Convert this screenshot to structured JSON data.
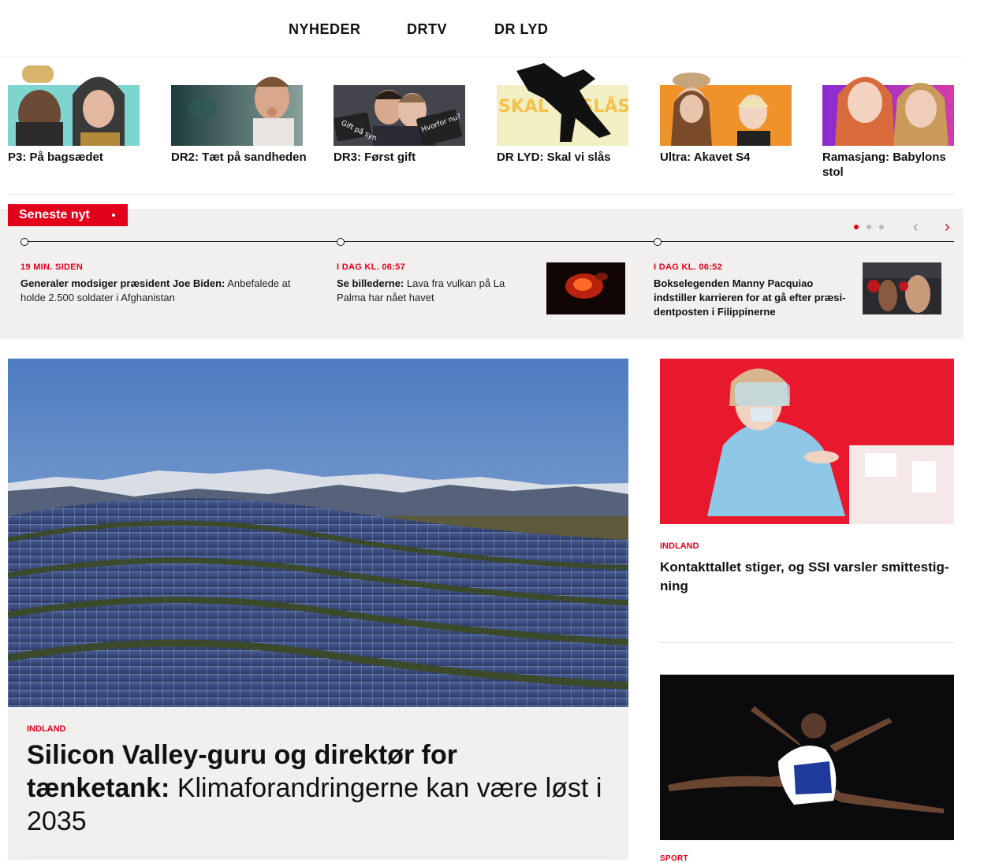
{
  "nav": {
    "items": [
      "NYHEDER",
      "DRTV",
      "DR LYD"
    ]
  },
  "promos": [
    {
      "label": "P3: På bagsædet"
    },
    {
      "label": "DR2: Tæt på sandheden"
    },
    {
      "label": "DR3: Først gift",
      "sign1": "Gift på syn",
      "sign2": "Hvorfor nu?"
    },
    {
      "label": "DR LYD: Skal vi slås",
      "art": "SKAL VI SLÅS?"
    },
    {
      "label": "Ultra: Akavet S4"
    },
    {
      "label": "Ramasjang: Babylons stol"
    }
  ],
  "latest": {
    "tag": "Seneste nyt",
    "items": [
      {
        "time": "19 MIN. SIDEN",
        "bold": "Generaler modsiger præsident Joe Biden:",
        "rest": " Anbefalede at holde 2.500 soldater i Afghanistan"
      },
      {
        "time": "I DAG KL. 06:57",
        "bold": "Se billederne:",
        "rest": " Lava fra vulkan på La Palma har nået havet"
      },
      {
        "time": "I DAG KL. 06:52",
        "bold": "Bokselegenden Manny Pacquiao indstiller karrieren for at gå efter præsi-dentposten i Filippinerne",
        "rest": ""
      }
    ]
  },
  "hero": {
    "kicker": "INDLAND",
    "title_bold": "Silicon Valley-guru og direktør for tænketank:",
    "title_rest": " Klimaforandringerne kan være løst i 2035"
  },
  "side": {
    "kicker": "INDLAND",
    "title": "Kontakttallet stiger, og SSI varsler smittestig-ning",
    "next_kicker": "SPORT"
  },
  "colors": {
    "accent": "#e3001b",
    "panel": "#f2f0ef"
  }
}
